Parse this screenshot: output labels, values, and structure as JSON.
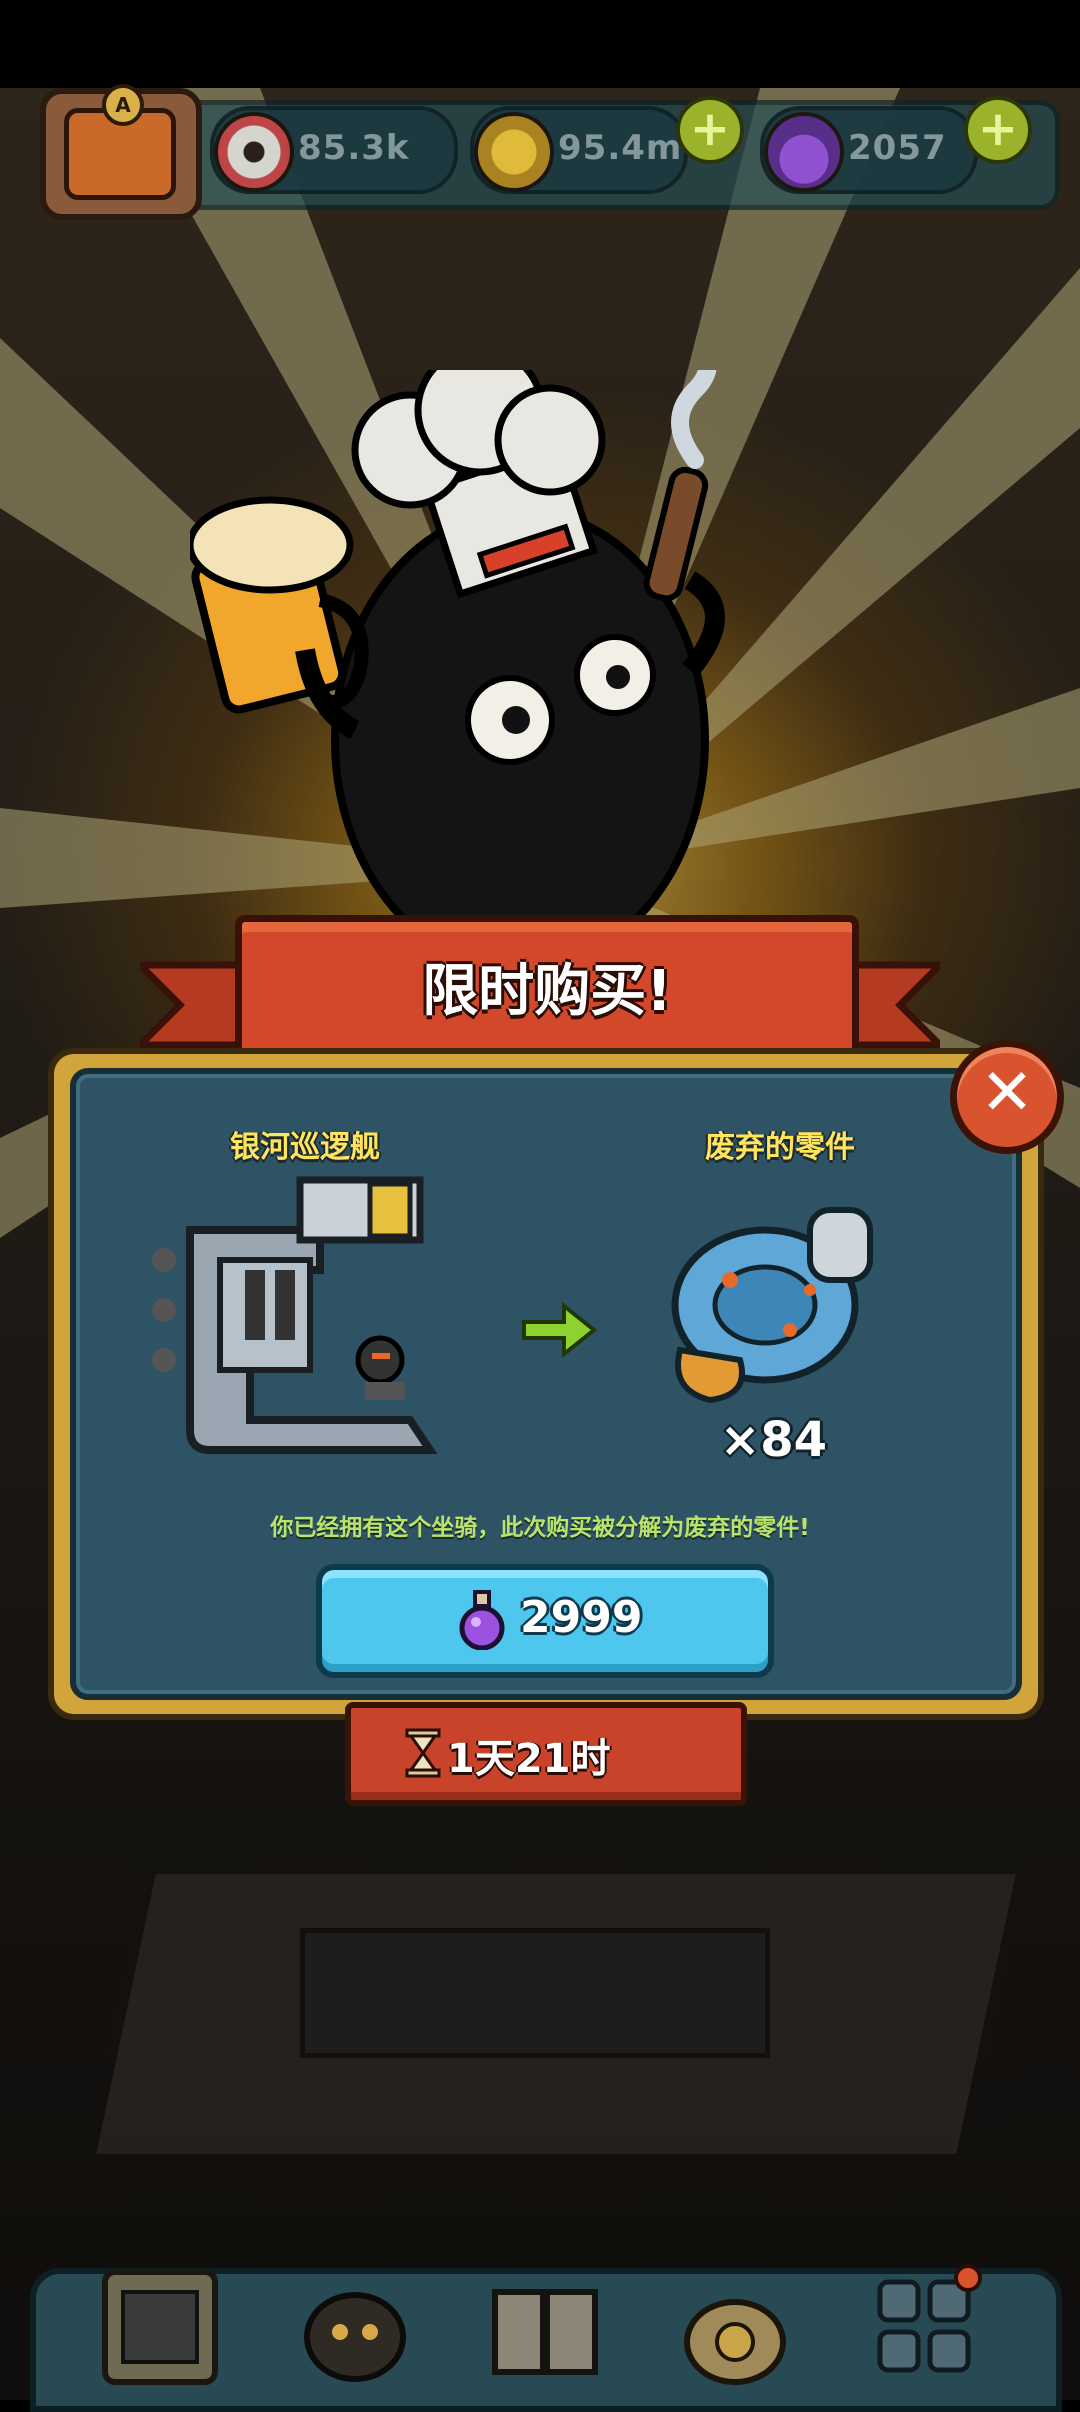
{
  "hud": {
    "eyes": "85.3k",
    "coins": "95.4m",
    "potions": "2057",
    "avatar_badge": "A"
  },
  "offer": {
    "title": "限时购买!",
    "item_left_name": "银河巡逻舰",
    "item_right_name": "废弃的零件",
    "item_right_count": "×84",
    "notice": "你已经拥有这个坐骑，此次购买被分解为废弃的零件!",
    "price": "2999",
    "timer": "1天21时",
    "close_glyph": "✕"
  },
  "icons": {
    "eye": "eye-icon",
    "coin": "coin-icon",
    "potion": "potion-icon",
    "arrow": "green-arrow-icon",
    "hourglass": "hourglass-icon"
  },
  "colors": {
    "banner_red": "#d3472b",
    "panel_teal": "#2d5364",
    "panel_gold": "#d2a53a",
    "button_blue": "#4ec7ee",
    "title_yellow": "#ffe45c",
    "notice_green": "#b9e36a",
    "arrow_green": "#8fd12f"
  }
}
